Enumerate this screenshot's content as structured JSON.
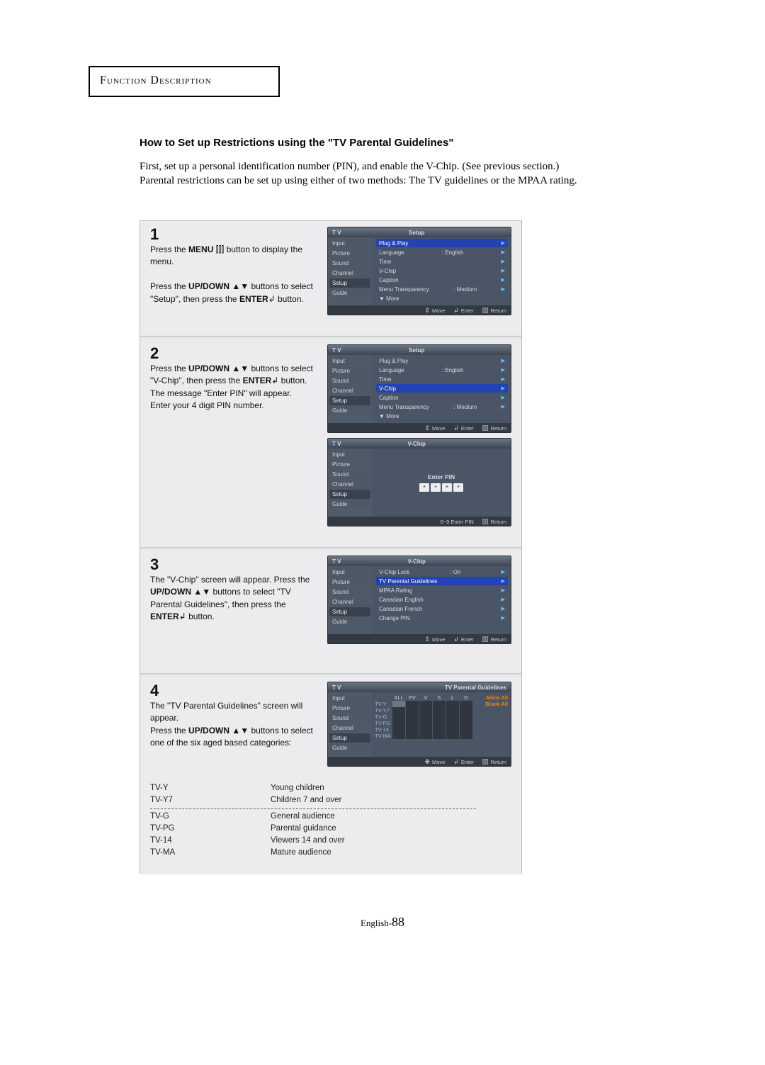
{
  "section_label": "Function Description",
  "article_title": "How to Set up Restrictions using the \"TV Parental Guidelines\"",
  "intro_text": "First, set up a personal identification number (PIN), and enable the V-Chip. (See previous section.) Parental restrictions can be set up using either of two methods: The TV guidelines or the MPAA rating.",
  "page_num_prefix": "English-",
  "page_num": "88",
  "osd_common": {
    "tv_label": "T V",
    "left_items": [
      "Input",
      "Picture",
      "Sound",
      "Channel",
      "Setup",
      "Guide"
    ],
    "footer_move": "Move",
    "footer_enter": "Enter",
    "footer_return": "Return",
    "footer_enter_pin": "0~9 Enter PIN"
  },
  "setup_menu": {
    "title": "Setup",
    "rows": [
      {
        "l": "Plug & Play",
        "r": ""
      },
      {
        "l": "Language",
        "r": ": English"
      },
      {
        "l": "Time",
        "r": ""
      },
      {
        "l": "V-Chip",
        "r": ""
      },
      {
        "l": "Caption",
        "r": ""
      },
      {
        "l": "Menu Transparency",
        "r": ": Medium"
      },
      {
        "l": "▼  More",
        "r": ""
      }
    ]
  },
  "vchip_menu": {
    "title": "V-Chip",
    "rows": [
      {
        "l": "V-Chip Lock",
        "r": ": On"
      },
      {
        "l": "TV Parental Guidelines",
        "r": ""
      },
      {
        "l": "MPAA Rating",
        "r": ""
      },
      {
        "l": "Canadian English",
        "r": ""
      },
      {
        "l": "Canadian French",
        "r": ""
      },
      {
        "l": "Change PIN",
        "r": ""
      }
    ]
  },
  "pin_panel": {
    "label": "Enter PIN",
    "mask": "*"
  },
  "guidelines_panel": {
    "title": "TV Parental Guidelines",
    "head": [
      "ALL",
      "FV",
      "V",
      "S",
      "L",
      "D"
    ],
    "action_allow": "Allow All",
    "action_block": "Block All",
    "ratings": [
      "TV-Y",
      "TV-Y7",
      "TV-G",
      "TV-PG",
      "TV-14",
      "TV-MA"
    ]
  },
  "steps": {
    "1": {
      "num": "1",
      "lines": [
        [
          "Press the ",
          "MENU",
          " ",
          "⫿⫿⫿",
          " button to display the menu."
        ],
        [
          "Press the ",
          "UP/DOWN",
          " ",
          "▲▼",
          " buttons to select \"Setup\", then press the ",
          "ENTER",
          "↲",
          " button."
        ]
      ]
    },
    "2": {
      "num": "2",
      "lines": [
        [
          "Press the ",
          "UP/DOWN",
          " ",
          "▲▼",
          " buttons  to select \"V-Chip\", then press the ",
          "ENTER",
          "↲",
          " button."
        ],
        [
          "The message \"Enter PIN\" will appear. Enter your 4 digit PIN number."
        ]
      ]
    },
    "3": {
      "num": "3",
      "lines": [
        [
          "The \"V-Chip\" screen will appear. Press the ",
          "UP/DOWN",
          " ",
          "▲▼",
          "  buttons to select \"TV Parental Guidelines\", then press the ",
          "ENTER",
          "↲",
          "   button."
        ]
      ]
    },
    "4": {
      "num": "4",
      "lines": [
        [
          "The \"TV Parental Guidelines\" screen will appear."
        ],
        [
          "Press the ",
          "UP/DOWN",
          " ",
          "▲▼",
          " buttons to select one of the six aged based categories:"
        ]
      ]
    }
  },
  "ratings_table": [
    {
      "code": "TV-Y",
      "desc": "Young children"
    },
    {
      "code": "TV-Y7",
      "desc": "Children 7 and over"
    }
  ],
  "ratings_table2": [
    {
      "code": "TV-G",
      "desc": "General audience"
    },
    {
      "code": "TV-PG",
      "desc": "Parental guidance"
    },
    {
      "code": "TV-14",
      "desc": "Viewers 14 and over"
    },
    {
      "code": "TV-MA",
      "desc": "Mature audience"
    }
  ]
}
